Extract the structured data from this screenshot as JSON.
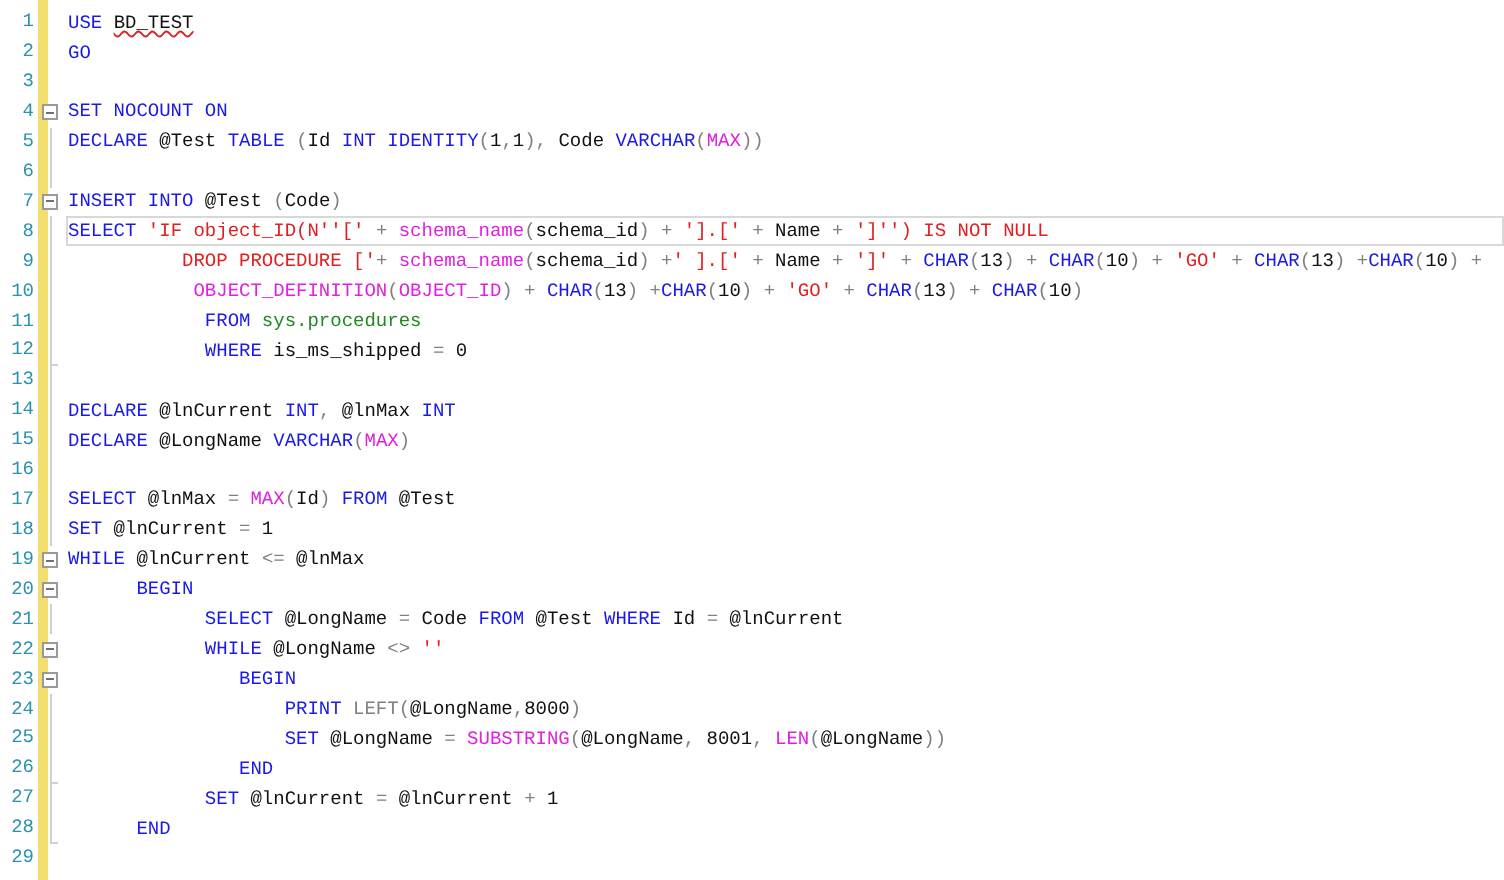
{
  "editor": {
    "lines": [
      {
        "number": "1",
        "kind": "plain",
        "current": false,
        "tokens": [
          {
            "kind": "keyword",
            "text": "USE "
          },
          {
            "kind": "misspelled",
            "text": "BD_TEST"
          }
        ]
      },
      {
        "number": "2",
        "kind": "plain",
        "current": false,
        "tokens": [
          {
            "kind": "keyword",
            "text": "GO"
          }
        ]
      },
      {
        "number": "3",
        "kind": "plain",
        "current": false
      },
      {
        "number": "4",
        "kind": "foldstart",
        "current": false,
        "tokens": [
          {
            "kind": "keyword",
            "text": "SET NOCOUNT ON"
          }
        ]
      },
      {
        "number": "5",
        "kind": "foldbody",
        "current": false,
        "tokens": [
          {
            "kind": "keyword",
            "text": "DECLARE"
          },
          {
            "kind": "plain",
            "text": " @Test "
          },
          {
            "kind": "keyword",
            "text": "TABLE "
          },
          {
            "kind": "operator",
            "text": "("
          },
          {
            "kind": "plain",
            "text": "Id "
          },
          {
            "kind": "keyword",
            "text": "INT IDENTITY"
          },
          {
            "kind": "operator",
            "text": "("
          },
          {
            "kind": "plain",
            "text": "1"
          },
          {
            "kind": "operator",
            "text": ","
          },
          {
            "kind": "plain",
            "text": "1"
          },
          {
            "kind": "operator",
            "text": "),"
          },
          {
            "kind": "plain",
            "text": " Code "
          },
          {
            "kind": "keyword",
            "text": "VARCHAR"
          },
          {
            "kind": "operator",
            "text": "("
          },
          {
            "kind": "function",
            "text": "MAX"
          },
          {
            "kind": "operator",
            "text": "))"
          }
        ]
      },
      {
        "number": "6",
        "kind": "foldbody",
        "current": false
      },
      {
        "number": "7",
        "kind": "foldstart",
        "current": false,
        "tokens": [
          {
            "kind": "keyword",
            "text": "INSERT INTO"
          },
          {
            "kind": "plain",
            "text": " @Test "
          },
          {
            "kind": "operator",
            "text": "("
          },
          {
            "kind": "plain",
            "text": "Code"
          },
          {
            "kind": "operator",
            "text": ")"
          }
        ]
      },
      {
        "number": "8",
        "kind": "foldbody",
        "current": true,
        "tokens": [
          {
            "kind": "keyword",
            "text": "SELECT "
          },
          {
            "kind": "string",
            "text": "'IF object_ID(N''['"
          },
          {
            "kind": "operator",
            "text": " + "
          },
          {
            "kind": "function",
            "text": "schema_name"
          },
          {
            "kind": "operator",
            "text": "("
          },
          {
            "kind": "plain",
            "text": "schema_id"
          },
          {
            "kind": "operator",
            "text": ") + "
          },
          {
            "kind": "string",
            "text": "'].['"
          },
          {
            "kind": "operator",
            "text": " + "
          },
          {
            "kind": "plain",
            "text": "Name"
          },
          {
            "kind": "operator",
            "text": " + "
          },
          {
            "kind": "string",
            "text": "']'') IS NOT NULL"
          }
        ]
      },
      {
        "number": "9",
        "kind": "foldbody",
        "current": false,
        "tokens": [
          {
            "kind": "string",
            "text": "          DROP PROCEDURE ['"
          },
          {
            "kind": "operator",
            "text": "+ "
          },
          {
            "kind": "function",
            "text": "schema_name"
          },
          {
            "kind": "operator",
            "text": "("
          },
          {
            "kind": "plain",
            "text": "schema_id"
          },
          {
            "kind": "operator",
            "text": ") +"
          },
          {
            "kind": "string",
            "text": "' ].['"
          },
          {
            "kind": "operator",
            "text": " + "
          },
          {
            "kind": "plain",
            "text": "Name"
          },
          {
            "kind": "operator",
            "text": " + "
          },
          {
            "kind": "string",
            "text": "']'"
          },
          {
            "kind": "operator",
            "text": " + "
          },
          {
            "kind": "keyword",
            "text": "CHAR"
          },
          {
            "kind": "operator",
            "text": "("
          },
          {
            "kind": "plain",
            "text": "13"
          },
          {
            "kind": "operator",
            "text": ") + "
          },
          {
            "kind": "keyword",
            "text": "CHAR"
          },
          {
            "kind": "operator",
            "text": "("
          },
          {
            "kind": "plain",
            "text": "10"
          },
          {
            "kind": "operator",
            "text": ") + "
          },
          {
            "kind": "string",
            "text": "'GO'"
          },
          {
            "kind": "operator",
            "text": " + "
          },
          {
            "kind": "keyword",
            "text": "CHAR"
          },
          {
            "kind": "operator",
            "text": "("
          },
          {
            "kind": "plain",
            "text": "13"
          },
          {
            "kind": "operator",
            "text": ") +"
          },
          {
            "kind": "keyword",
            "text": "CHAR"
          },
          {
            "kind": "operator",
            "text": "("
          },
          {
            "kind": "plain",
            "text": "10"
          },
          {
            "kind": "operator",
            "text": ") +"
          }
        ]
      },
      {
        "number": "10",
        "kind": "foldbody",
        "current": false,
        "tokens": [
          {
            "kind": "function",
            "text": "           OBJECT_DEFINITION"
          },
          {
            "kind": "operator",
            "text": "("
          },
          {
            "kind": "function",
            "text": "OBJECT_ID"
          },
          {
            "kind": "operator",
            "text": ") + "
          },
          {
            "kind": "keyword",
            "text": "CHAR"
          },
          {
            "kind": "operator",
            "text": "("
          },
          {
            "kind": "plain",
            "text": "13"
          },
          {
            "kind": "operator",
            "text": ") +"
          },
          {
            "kind": "keyword",
            "text": "CHAR"
          },
          {
            "kind": "operator",
            "text": "("
          },
          {
            "kind": "plain",
            "text": "10"
          },
          {
            "kind": "operator",
            "text": ") + "
          },
          {
            "kind": "string",
            "text": "'GO'"
          },
          {
            "kind": "operator",
            "text": " + "
          },
          {
            "kind": "keyword",
            "text": "CHAR"
          },
          {
            "kind": "operator",
            "text": "("
          },
          {
            "kind": "plain",
            "text": "13"
          },
          {
            "kind": "operator",
            "text": ") + "
          },
          {
            "kind": "keyword",
            "text": "CHAR"
          },
          {
            "kind": "operator",
            "text": "("
          },
          {
            "kind": "plain",
            "text": "10"
          },
          {
            "kind": "operator",
            "text": ")"
          }
        ]
      },
      {
        "number": "11",
        "kind": "foldbody",
        "current": false,
        "tokens": [
          {
            "kind": "keyword",
            "text": "            FROM "
          },
          {
            "kind": "system",
            "text": "sys.procedures"
          }
        ]
      },
      {
        "number": "12",
        "kind": "foldend",
        "current": false,
        "tokens": [
          {
            "kind": "keyword",
            "text": "            WHERE"
          },
          {
            "kind": "plain",
            "text": " is_ms_shipped "
          },
          {
            "kind": "operator",
            "text": "="
          },
          {
            "kind": "plain",
            "text": " 0"
          }
        ]
      },
      {
        "number": "13",
        "kind": "foldbody",
        "current": false
      },
      {
        "number": "14",
        "kind": "foldbody",
        "current": false,
        "tokens": [
          {
            "kind": "keyword",
            "text": "DECLARE"
          },
          {
            "kind": "plain",
            "text": " @lnCurrent "
          },
          {
            "kind": "keyword",
            "text": "INT"
          },
          {
            "kind": "operator",
            "text": ","
          },
          {
            "kind": "plain",
            "text": " @lnMax "
          },
          {
            "kind": "keyword",
            "text": "INT"
          }
        ]
      },
      {
        "number": "15",
        "kind": "foldbody",
        "current": false,
        "tokens": [
          {
            "kind": "keyword",
            "text": "DECLARE"
          },
          {
            "kind": "plain",
            "text": " @LongName "
          },
          {
            "kind": "keyword",
            "text": "VARCHAR"
          },
          {
            "kind": "operator",
            "text": "("
          },
          {
            "kind": "function",
            "text": "MAX"
          },
          {
            "kind": "operator",
            "text": ")"
          }
        ]
      },
      {
        "number": "16",
        "kind": "foldbody",
        "current": false
      },
      {
        "number": "17",
        "kind": "foldbody",
        "current": false,
        "tokens": [
          {
            "kind": "keyword",
            "text": "SELECT"
          },
          {
            "kind": "plain",
            "text": " @lnMax "
          },
          {
            "kind": "operator",
            "text": "= "
          },
          {
            "kind": "function",
            "text": "MAX"
          },
          {
            "kind": "operator",
            "text": "("
          },
          {
            "kind": "plain",
            "text": "Id"
          },
          {
            "kind": "operator",
            "text": ") "
          },
          {
            "kind": "keyword",
            "text": "FROM"
          },
          {
            "kind": "plain",
            "text": " @Test"
          }
        ]
      },
      {
        "number": "18",
        "kind": "foldbody",
        "current": false,
        "tokens": [
          {
            "kind": "keyword",
            "text": "SET"
          },
          {
            "kind": "plain",
            "text": " @lnCurrent "
          },
          {
            "kind": "operator",
            "text": "="
          },
          {
            "kind": "plain",
            "text": " 1"
          }
        ]
      },
      {
        "number": "19",
        "kind": "foldstart",
        "current": false,
        "tokens": [
          {
            "kind": "keyword",
            "text": "WHILE"
          },
          {
            "kind": "plain",
            "text": " @lnCurrent "
          },
          {
            "kind": "operator",
            "text": "<="
          },
          {
            "kind": "plain",
            "text": " @lnMax"
          }
        ]
      },
      {
        "number": "20",
        "kind": "foldstart",
        "current": false,
        "tokens": [
          {
            "kind": "keyword",
            "text": "      BEGIN"
          }
        ]
      },
      {
        "number": "21",
        "kind": "foldbody",
        "current": false,
        "tokens": [
          {
            "kind": "keyword",
            "text": "            SELECT"
          },
          {
            "kind": "plain",
            "text": " @LongName "
          },
          {
            "kind": "operator",
            "text": "="
          },
          {
            "kind": "plain",
            "text": " Code "
          },
          {
            "kind": "keyword",
            "text": "FROM"
          },
          {
            "kind": "plain",
            "text": " @Test "
          },
          {
            "kind": "keyword",
            "text": "WHERE"
          },
          {
            "kind": "plain",
            "text": " Id "
          },
          {
            "kind": "operator",
            "text": "="
          },
          {
            "kind": "plain",
            "text": " @lnCurrent"
          }
        ]
      },
      {
        "number": "22",
        "kind": "foldstart",
        "current": false,
        "tokens": [
          {
            "kind": "keyword",
            "text": "            WHILE"
          },
          {
            "kind": "plain",
            "text": " @LongName "
          },
          {
            "kind": "operator",
            "text": "<> "
          },
          {
            "kind": "string",
            "text": "''"
          }
        ]
      },
      {
        "number": "23",
        "kind": "foldstart",
        "current": false,
        "tokens": [
          {
            "kind": "keyword",
            "text": "               BEGIN"
          }
        ]
      },
      {
        "number": "24",
        "kind": "foldbody",
        "current": false,
        "tokens": [
          {
            "kind": "keyword",
            "text": "                   PRINT "
          },
          {
            "kind": "operator",
            "text": "LEFT("
          },
          {
            "kind": "plain",
            "text": "@LongName"
          },
          {
            "kind": "operator",
            "text": ","
          },
          {
            "kind": "plain",
            "text": "8000"
          },
          {
            "kind": "operator",
            "text": ")"
          }
        ]
      },
      {
        "number": "25",
        "kind": "foldbody",
        "current": false,
        "tokens": [
          {
            "kind": "keyword",
            "text": "                   SET"
          },
          {
            "kind": "plain",
            "text": " @LongName "
          },
          {
            "kind": "operator",
            "text": "= "
          },
          {
            "kind": "function",
            "text": "SUBSTRING"
          },
          {
            "kind": "operator",
            "text": "("
          },
          {
            "kind": "plain",
            "text": "@LongName"
          },
          {
            "kind": "operator",
            "text": ","
          },
          {
            "kind": "plain",
            "text": " 8001"
          },
          {
            "kind": "operator",
            "text": ", "
          },
          {
            "kind": "function",
            "text": "LEN"
          },
          {
            "kind": "operator",
            "text": "("
          },
          {
            "kind": "plain",
            "text": "@LongName"
          },
          {
            "kind": "operator",
            "text": "))"
          }
        ]
      },
      {
        "number": "26",
        "kind": "foldend",
        "current": false,
        "tokens": [
          {
            "kind": "keyword",
            "text": "               END"
          }
        ]
      },
      {
        "number": "27",
        "kind": "foldbody",
        "current": false,
        "tokens": [
          {
            "kind": "keyword",
            "text": "            SET"
          },
          {
            "kind": "plain",
            "text": " @lnCurrent "
          },
          {
            "kind": "operator",
            "text": "="
          },
          {
            "kind": "plain",
            "text": " @lnCurrent "
          },
          {
            "kind": "operator",
            "text": "+"
          },
          {
            "kind": "plain",
            "text": " 1"
          }
        ]
      },
      {
        "number": "28",
        "kind": "foldend",
        "current": false,
        "tokens": [
          {
            "kind": "keyword",
            "text": "      END"
          }
        ]
      },
      {
        "number": "29",
        "kind": "plain",
        "current": false
      }
    ]
  }
}
